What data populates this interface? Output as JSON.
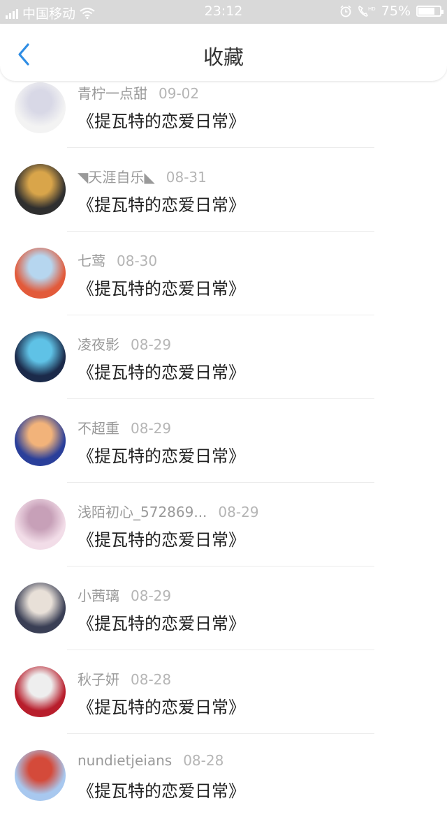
{
  "status_bar": {
    "carrier": "中国移动",
    "time": "23:12",
    "battery_percent": "75%",
    "battery_level": 0.75
  },
  "header": {
    "title": "收藏",
    "back_icon": "chevron-left-icon"
  },
  "favorites": [
    {
      "name": "青柠一点甜",
      "date": "09-02",
      "title": "《提瓦特的恋爱日常》",
      "avatar_colors": [
        "#f3f3f3",
        "#d8d8e6"
      ]
    },
    {
      "name": "◥天涯自乐◣",
      "date": "08-31",
      "title": "《提瓦特的恋爱日常》",
      "avatar_colors": [
        "#2f2f2f",
        "#d9a54a"
      ]
    },
    {
      "name": "七莺",
      "date": "08-30",
      "title": "《提瓦特的恋爱日常》",
      "avatar_colors": [
        "#e25a3a",
        "#b6d6ef"
      ]
    },
    {
      "name": "凌夜影",
      "date": "08-29",
      "title": "《提瓦特的恋爱日常》",
      "avatar_colors": [
        "#1b2a4a",
        "#5fc2e6"
      ]
    },
    {
      "name": "不超重",
      "date": "08-29",
      "title": "《提瓦特的恋爱日常》",
      "avatar_colors": [
        "#2a3f9a",
        "#f2b37a"
      ]
    },
    {
      "name": "浅陌初心_572869...",
      "date": "08-29",
      "title": "《提瓦特的恋爱日常》",
      "avatar_colors": [
        "#f2dde8",
        "#c7a0b8"
      ]
    },
    {
      "name": "小茜璃",
      "date": "08-29",
      "title": "《提瓦特的恋爱日常》",
      "avatar_colors": [
        "#3a3f55",
        "#e8e0d8"
      ]
    },
    {
      "name": "秋子妍",
      "date": "08-28",
      "title": "《提瓦特的恋爱日常》",
      "avatar_colors": [
        "#b81e2c",
        "#eeeeee"
      ]
    },
    {
      "name": "nundietjeians",
      "date": "08-28",
      "title": "《提瓦特的恋爱日常》",
      "avatar_colors": [
        "#a8c8ef",
        "#d44a3a"
      ]
    }
  ]
}
